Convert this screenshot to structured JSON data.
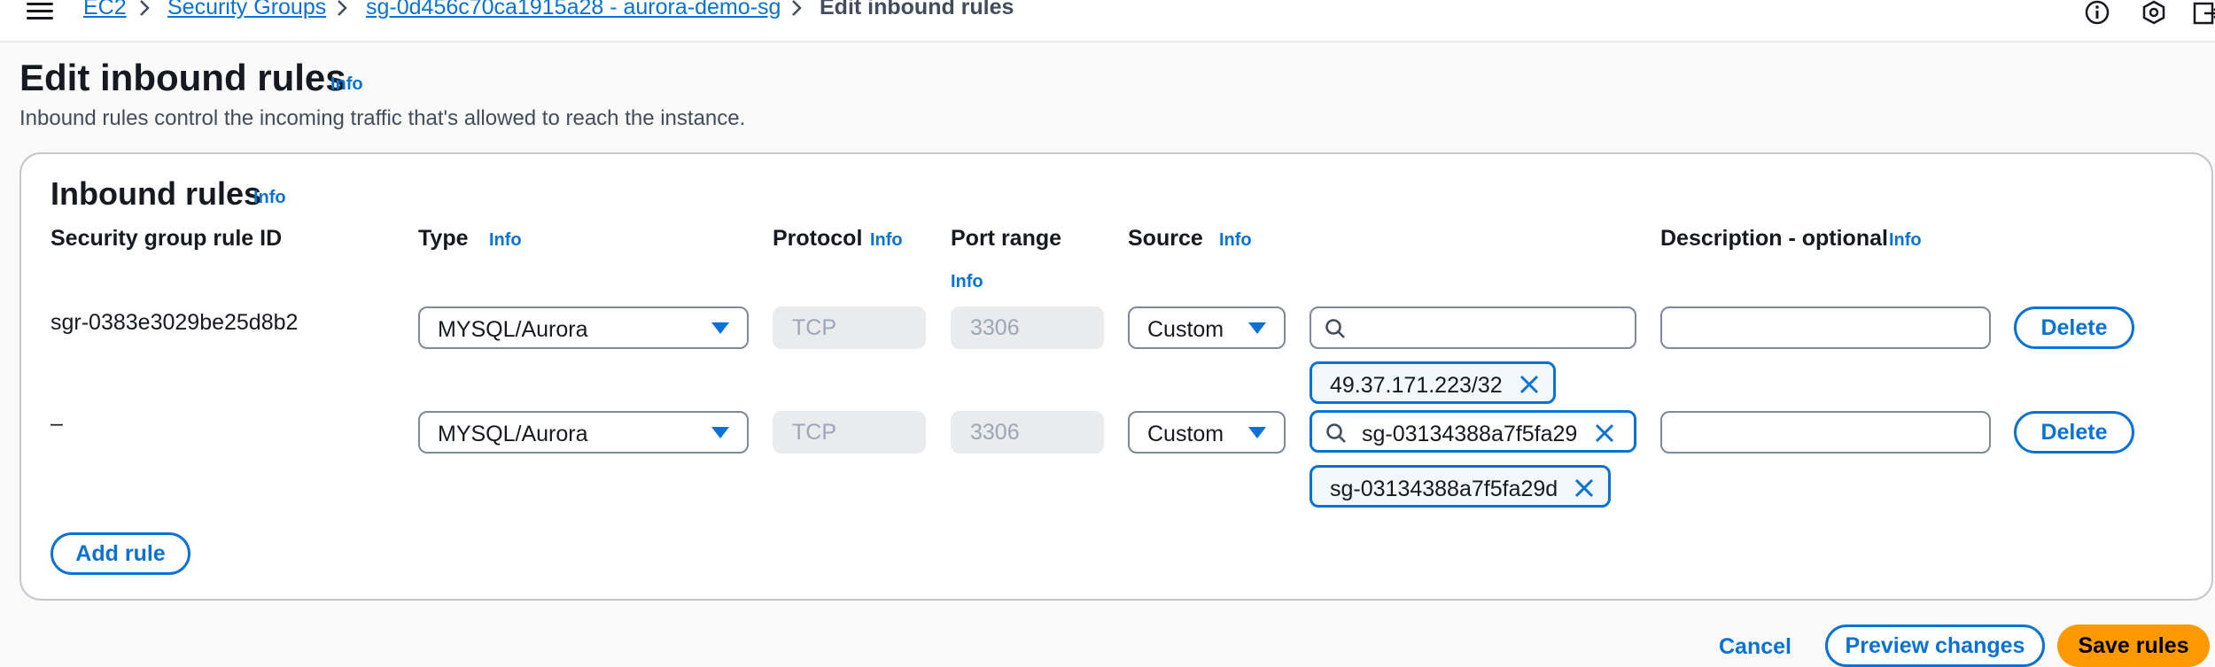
{
  "breadcrumb": {
    "items": [
      "EC2",
      "Security Groups",
      "sg-0d456c70ca1915a28 - aurora-demo-sg"
    ],
    "current": "Edit inbound rules"
  },
  "header_icons": [
    "info-circle-icon",
    "notifications-icon",
    "external-launch-icon"
  ],
  "page": {
    "title": "Edit inbound rules",
    "info": "Info",
    "description": "Inbound rules control the incoming traffic that's allowed to reach the instance."
  },
  "panel": {
    "title": "Inbound rules",
    "info": "Info",
    "columns": {
      "rule_id": "Security group rule ID",
      "type": "Type",
      "protocol": "Protocol",
      "port_range": "Port range",
      "source": "Source",
      "description": "Description - optional"
    },
    "info_label": "Info"
  },
  "rules": [
    {
      "rule_id": "sgr-0383e3029be25d8b2",
      "type": "MYSQL/Aurora",
      "protocol": "TCP",
      "port_range": "3306",
      "source_type": "Custom",
      "source_search": "",
      "source_token": "49.37.171.223/32",
      "description": "",
      "delete_label": "Delete"
    },
    {
      "rule_id": "–",
      "type": "MYSQL/Aurora",
      "protocol": "TCP",
      "port_range": "3306",
      "source_type": "Custom",
      "source_search": "sg-03134388a7f5fa29",
      "source_token": "sg-03134388a7f5fa29d",
      "description": "",
      "delete_label": "Delete"
    }
  ],
  "actions": {
    "add_rule": "Add rule",
    "cancel": "Cancel",
    "preview": "Preview changes",
    "save": "Save rules"
  },
  "colors": {
    "accent": "#0972d3",
    "primary_button": "#ff9900"
  }
}
